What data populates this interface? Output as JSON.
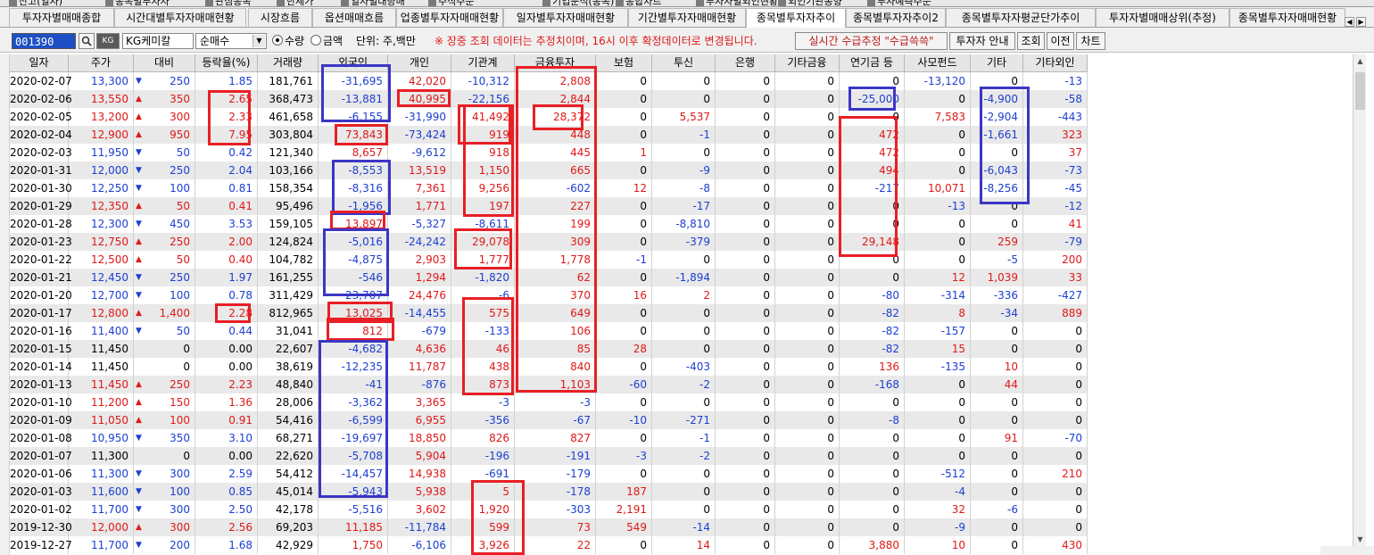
{
  "top_tabs": [
    "잔고(일자)",
    "종목별투자자",
    "관심종목",
    "한세가",
    "일자별대량매",
    "주식주문",
    "기업분석(종목)",
    "종합차트",
    "투자자별외인현황",
    "외인기관동향",
    "투자예측주문"
  ],
  "tabs": [
    {
      "label": "투자자별매매종합",
      "active": false
    },
    {
      "label": "시간대별투자자매매현황",
      "active": false
    },
    {
      "label": "시장흐름",
      "active": false
    },
    {
      "label": "옵션매매흐름",
      "active": false
    },
    {
      "label": "업종별투자자매매현황",
      "active": false
    },
    {
      "label": "일자별투자자매매현황",
      "active": false
    },
    {
      "label": "기간별투자자매매현황",
      "active": false
    },
    {
      "label": "종목별투자자추이",
      "active": true
    },
    {
      "label": "종목별투자자추이2",
      "active": false
    },
    {
      "label": "종목별투자자평균단가추이",
      "active": false
    },
    {
      "label": "투자자별매매상위(추정)",
      "active": false
    },
    {
      "label": "종목별투자자매매현황",
      "active": false
    }
  ],
  "toolbar": {
    "code": "001390",
    "stock_name": "KG케미칼",
    "mode_select": "순매수",
    "radio_quantity": "수량",
    "radio_amount": "금액",
    "unit_label": "단위: 주,백만",
    "notice": "※ 장중 조회 데이터는 추정치이며, 16시 이후 확정데이터로 변경됩니다.",
    "realtime_button": "실시간 수급추정 \"수급쓱쓱\"",
    "investor_guide_button": "투자자 안내",
    "query_button": "조회",
    "prev_button": "이전",
    "chart_button": "차트"
  },
  "columns": [
    "일자",
    "주가",
    "대비",
    "등락율(%)",
    "거래량",
    "외국인",
    "개인",
    "기관계",
    "금융투자",
    "보험",
    "투신",
    "은행",
    "기타금융",
    "연기금 등",
    "사모펀드",
    "기타",
    "기타외인"
  ],
  "rows": [
    {
      "date": "2020-02-07",
      "price": "13,300",
      "dir": "down",
      "chg": "250",
      "rate": "1.85",
      "vol": "181,761",
      "v": [
        "-31,695",
        "42,020",
        "-10,312",
        "2,808",
        "0",
        "0",
        "0",
        "0",
        "0",
        "-13,120",
        "0",
        "-13"
      ]
    },
    {
      "date": "2020-02-06",
      "price": "13,550",
      "dir": "up",
      "chg": "350",
      "rate": "2.65",
      "vol": "368,473",
      "v": [
        "-13,881",
        "40,995",
        "-22,156",
        "2,844",
        "0",
        "0",
        "0",
        "0",
        "-25,000",
        "0",
        "-4,900",
        "-58"
      ]
    },
    {
      "date": "2020-02-05",
      "price": "13,200",
      "dir": "up",
      "chg": "300",
      "rate": "2.33",
      "vol": "461,658",
      "v": [
        "-6,155",
        "-31,990",
        "41,492",
        "28,372",
        "0",
        "5,537",
        "0",
        "0",
        "0",
        "7,583",
        "-2,904",
        "-443"
      ]
    },
    {
      "date": "2020-02-04",
      "price": "12,900",
      "dir": "up",
      "chg": "950",
      "rate": "7.95",
      "vol": "303,804",
      "v": [
        "73,843",
        "-73,424",
        "919",
        "448",
        "0",
        "-1",
        "0",
        "0",
        "472",
        "0",
        "-1,661",
        "323"
      ]
    },
    {
      "date": "2020-02-03",
      "price": "11,950",
      "dir": "down",
      "chg": "50",
      "rate": "0.42",
      "vol": "121,340",
      "v": [
        "8,657",
        "-9,612",
        "918",
        "445",
        "1",
        "0",
        "0",
        "0",
        "472",
        "0",
        "0",
        "37"
      ]
    },
    {
      "date": "2020-01-31",
      "price": "12,000",
      "dir": "down",
      "chg": "250",
      "rate": "2.04",
      "vol": "103,166",
      "v": [
        "-8,553",
        "13,519",
        "1,150",
        "665",
        "0",
        "-9",
        "0",
        "0",
        "494",
        "0",
        "-6,043",
        "-73"
      ]
    },
    {
      "date": "2020-01-30",
      "price": "12,250",
      "dir": "down",
      "chg": "100",
      "rate": "0.81",
      "vol": "158,354",
      "v": [
        "-8,316",
        "7,361",
        "9,256",
        "-602",
        "12",
        "-8",
        "0",
        "0",
        "-217",
        "10,071",
        "-8,256",
        "-45"
      ]
    },
    {
      "date": "2020-01-29",
      "price": "12,350",
      "dir": "up",
      "chg": "50",
      "rate": "0.41",
      "vol": "95,496",
      "v": [
        "-1,956",
        "1,771",
        "197",
        "227",
        "0",
        "-17",
        "0",
        "0",
        "0",
        "-13",
        "0",
        "-12"
      ]
    },
    {
      "date": "2020-01-28",
      "price": "12,300",
      "dir": "down",
      "chg": "450",
      "rate": "3.53",
      "vol": "159,105",
      "v": [
        "13,897",
        "-5,327",
        "-8,611",
        "199",
        "0",
        "-8,810",
        "0",
        "0",
        "0",
        "0",
        "0",
        "41"
      ]
    },
    {
      "date": "2020-01-23",
      "price": "12,750",
      "dir": "up",
      "chg": "250",
      "rate": "2.00",
      "vol": "124,824",
      "v": [
        "-5,016",
        "-24,242",
        "29,078",
        "309",
        "0",
        "-379",
        "0",
        "0",
        "29,148",
        "0",
        "259",
        "-79"
      ]
    },
    {
      "date": "2020-01-22",
      "price": "12,500",
      "dir": "up",
      "chg": "50",
      "rate": "0.40",
      "vol": "104,782",
      "v": [
        "-4,875",
        "2,903",
        "1,777",
        "1,778",
        "-1",
        "0",
        "0",
        "0",
        "0",
        "0",
        "-5",
        "200"
      ]
    },
    {
      "date": "2020-01-21",
      "price": "12,450",
      "dir": "down",
      "chg": "250",
      "rate": "1.97",
      "vol": "161,255",
      "v": [
        "-546",
        "1,294",
        "-1,820",
        "62",
        "0",
        "-1,894",
        "0",
        "0",
        "0",
        "12",
        "1,039",
        "33"
      ]
    },
    {
      "date": "2020-01-20",
      "price": "12,700",
      "dir": "down",
      "chg": "100",
      "rate": "0.78",
      "vol": "311,429",
      "v": [
        "-23,707",
        "24,476",
        "-6",
        "370",
        "16",
        "2",
        "0",
        "0",
        "-80",
        "-314",
        "-336",
        "-427"
      ]
    },
    {
      "date": "2020-01-17",
      "price": "12,800",
      "dir": "up",
      "chg": "1,400",
      "rate": "2.28",
      "vol": "812,965",
      "v": [
        "13,025",
        "-14,455",
        "575",
        "649",
        "0",
        "0",
        "0",
        "0",
        "-82",
        "8",
        "-34",
        "889"
      ]
    },
    {
      "date": "2020-01-16",
      "price": "11,400",
      "dir": "down",
      "chg": "50",
      "rate": "0.44",
      "vol": "31,041",
      "v": [
        "812",
        "-679",
        "-133",
        "106",
        "0",
        "0",
        "0",
        "0",
        "-82",
        "-157",
        "0",
        "0"
      ]
    },
    {
      "date": "2020-01-15",
      "price": "11,450",
      "dir": "none",
      "chg": "0",
      "rate": "0.00",
      "vol": "22,607",
      "v": [
        "-4,682",
        "4,636",
        "46",
        "85",
        "28",
        "0",
        "0",
        "0",
        "-82",
        "15",
        "0",
        "0"
      ]
    },
    {
      "date": "2020-01-14",
      "price": "11,450",
      "dir": "none",
      "chg": "0",
      "rate": "0.00",
      "vol": "38,619",
      "v": [
        "-12,235",
        "11,787",
        "438",
        "840",
        "0",
        "-403",
        "0",
        "0",
        "136",
        "-135",
        "10",
        "0"
      ]
    },
    {
      "date": "2020-01-13",
      "price": "11,450",
      "dir": "up",
      "chg": "250",
      "rate": "2.23",
      "vol": "48,840",
      "v": [
        "-41",
        "-876",
        "873",
        "1,103",
        "-60",
        "-2",
        "0",
        "0",
        "-168",
        "0",
        "44",
        "0"
      ]
    },
    {
      "date": "2020-01-10",
      "price": "11,200",
      "dir": "up",
      "chg": "150",
      "rate": "1.36",
      "vol": "28,006",
      "v": [
        "-3,362",
        "3,365",
        "-3",
        "-3",
        "0",
        "0",
        "0",
        "0",
        "0",
        "0",
        "0",
        "0"
      ]
    },
    {
      "date": "2020-01-09",
      "price": "11,050",
      "dir": "up",
      "chg": "100",
      "rate": "0.91",
      "vol": "54,416",
      "v": [
        "-6,599",
        "6,955",
        "-356",
        "-67",
        "-10",
        "-271",
        "0",
        "0",
        "-8",
        "0",
        "0",
        "0"
      ]
    },
    {
      "date": "2020-01-08",
      "price": "10,950",
      "dir": "down",
      "chg": "350",
      "rate": "3.10",
      "vol": "68,271",
      "v": [
        "-19,697",
        "18,850",
        "826",
        "827",
        "0",
        "-1",
        "0",
        "0",
        "0",
        "0",
        "91",
        "-70"
      ]
    },
    {
      "date": "2020-01-07",
      "price": "11,300",
      "dir": "none",
      "chg": "0",
      "rate": "0.00",
      "vol": "22,620",
      "v": [
        "-5,708",
        "5,904",
        "-196",
        "-191",
        "-3",
        "-2",
        "0",
        "0",
        "0",
        "0",
        "0",
        "0"
      ]
    },
    {
      "date": "2020-01-06",
      "price": "11,300",
      "dir": "down",
      "chg": "300",
      "rate": "2.59",
      "vol": "54,412",
      "v": [
        "-14,457",
        "14,938",
        "-691",
        "-179",
        "0",
        "0",
        "0",
        "0",
        "0",
        "-512",
        "0",
        "210"
      ]
    },
    {
      "date": "2020-01-03",
      "price": "11,600",
      "dir": "down",
      "chg": "100",
      "rate": "0.85",
      "vol": "45,014",
      "v": [
        "-5,943",
        "5,938",
        "5",
        "-178",
        "187",
        "0",
        "0",
        "0",
        "0",
        "-4",
        "0",
        "0"
      ]
    },
    {
      "date": "2020-01-02",
      "price": "11,700",
      "dir": "down",
      "chg": "300",
      "rate": "2.50",
      "vol": "42,178",
      "v": [
        "-5,516",
        "3,602",
        "1,920",
        "-303",
        "2,191",
        "0",
        "0",
        "0",
        "0",
        "32",
        "-6",
        "0"
      ]
    },
    {
      "date": "2019-12-30",
      "price": "12,000",
      "dir": "up",
      "chg": "300",
      "rate": "2.56",
      "vol": "69,203",
      "v": [
        "11,185",
        "-11,784",
        "599",
        "73",
        "549",
        "-14",
        "0",
        "0",
        "0",
        "-9",
        "0",
        "0"
      ]
    },
    {
      "date": "2019-12-27",
      "price": "11,700",
      "dir": "down",
      "chg": "200",
      "rate": "1.68",
      "vol": "42,929",
      "v": [
        "1,750",
        "-6,106",
        "3,926",
        "22",
        "0",
        "14",
        "0",
        "0",
        "3,880",
        "10",
        "0",
        "430"
      ]
    }
  ],
  "colors": {
    "up": "#e01818",
    "down": "#1c3fd2",
    "highlight_red": "#e81f25",
    "highlight_blue": "#3b36c5",
    "selected_code_bg": "#1e4fc4"
  },
  "icons": {
    "search": "magnifier-icon",
    "stock_badge": "stock-badge-icon",
    "select_arrow": "chevron-down-icon",
    "scroll_up": "scroll-up-icon",
    "scroll_down": "scroll-down-icon"
  }
}
